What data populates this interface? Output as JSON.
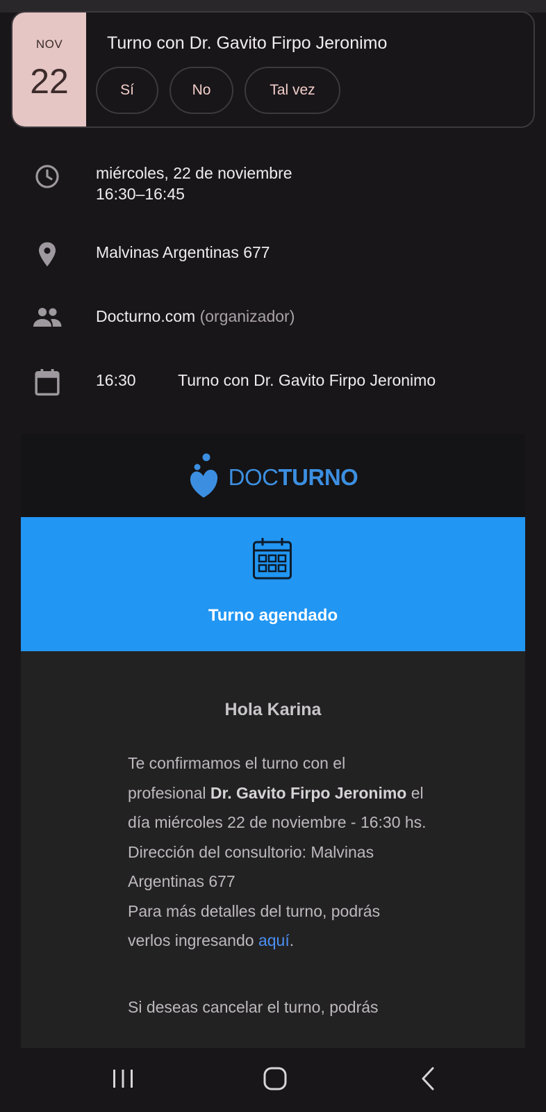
{
  "event": {
    "month": "NOV",
    "day": "22",
    "title": "Turno con Dr. Gavito Firpo Jeronimo",
    "rsvp": {
      "yes": "Sí",
      "no": "No",
      "maybe": "Tal vez"
    }
  },
  "details": {
    "date_line": "miércoles, 22 de noviembre",
    "time_line": "16:30–16:45",
    "location": "Malvinas Argentinas 677",
    "organizer": "Docturno.com",
    "organizer_role": "(organizador)",
    "agenda_time": "16:30",
    "agenda_title": "Turno con Dr. Gavito Firpo Jeronimo"
  },
  "email": {
    "logo_doc": "DOC",
    "logo_turno": "TURNO",
    "banner_title": "Turno agendado",
    "greeting": "Hola Karina",
    "p_intro": "Te confirmamos el turno con el profesional ",
    "p_doctor": "Dr. Gavito Firpo Jeronimo",
    "p_date": " el día miércoles 22 de noviembre - 16:30 hs.",
    "p_address": "Dirección del consultorio: Malvinas Argentinas 677",
    "p_details": "Para más detalles del turno, podrás verlos ingresando ",
    "p_link": "aquí",
    "p_link_end": ".",
    "p_cancel": "Si deseas cancelar el turno, podrás"
  },
  "colors": {
    "background": "#19161a",
    "date_box": "#e5c6c4",
    "banner": "#2196f3",
    "brand": "#3c8fe0",
    "link": "#4a8ff5"
  },
  "icons": [
    "clock-icon",
    "location-pin-icon",
    "people-icon",
    "calendar-icon",
    "docturno-logo-icon",
    "calendar-grid-icon",
    "recents-icon",
    "home-icon",
    "back-icon"
  ]
}
